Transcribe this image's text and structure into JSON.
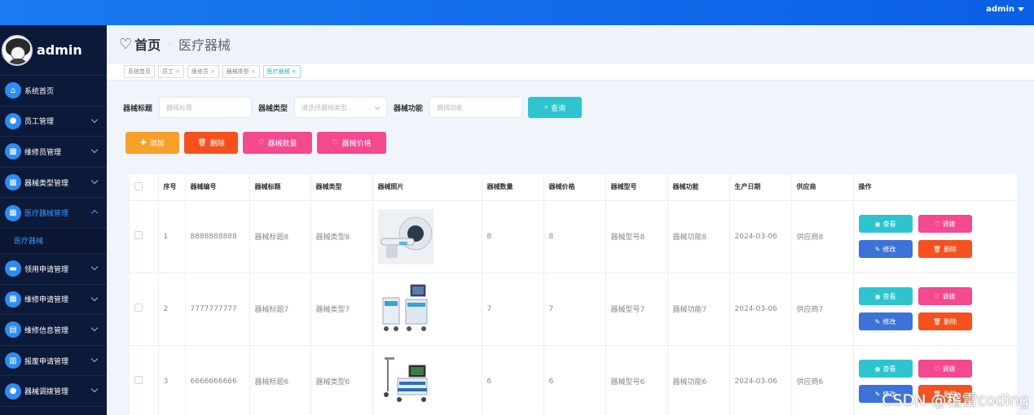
{
  "topbar": {
    "user": "admin"
  },
  "sidebar": {
    "brand": "admin",
    "items": [
      {
        "label": "系统首页",
        "icon": "home-icon",
        "glyph": "⌂",
        "expandable": false
      },
      {
        "label": "员工管理",
        "icon": "balloon-icon",
        "glyph": "●",
        "expandable": true
      },
      {
        "label": "维修员管理",
        "icon": "grid-icon",
        "glyph": "▦",
        "expandable": true
      },
      {
        "label": "器械类型管理",
        "icon": "grid-icon",
        "glyph": "▦",
        "expandable": true
      },
      {
        "label": "医疗器械管理",
        "icon": "grid-icon",
        "glyph": "▦",
        "expandable": true,
        "active": true,
        "sub": "医疗器械"
      },
      {
        "label": "领用申请管理",
        "icon": "ticket-icon",
        "glyph": "▬",
        "expandable": true
      },
      {
        "label": "维修申请管理",
        "icon": "grid-icon",
        "glyph": "▦",
        "expandable": true
      },
      {
        "label": "维修信息管理",
        "icon": "chart-icon",
        "glyph": "▤",
        "expandable": true
      },
      {
        "label": "报废申请管理",
        "icon": "bar-chart-icon",
        "glyph": "▥",
        "expandable": true
      },
      {
        "label": "器械调拨管理",
        "icon": "user-icon",
        "glyph": "●",
        "expandable": true
      }
    ]
  },
  "breadcrumb": {
    "home": "首页",
    "current": "医疗器械"
  },
  "tags": [
    {
      "label": "系统首页",
      "closable": false,
      "active": false
    },
    {
      "label": "员工",
      "closable": true,
      "active": false
    },
    {
      "label": "维修员",
      "closable": true,
      "active": false
    },
    {
      "label": "器械类型",
      "closable": true,
      "active": false
    },
    {
      "label": "医疗器械",
      "closable": true,
      "active": true
    }
  ],
  "search": {
    "title_label": "器械标题",
    "title_placeholder": "器械标题",
    "type_label": "器械类型",
    "type_placeholder": "请选择器械类型",
    "func_label": "器械功能",
    "func_placeholder": "器械功能",
    "query_btn": "查询"
  },
  "actions": {
    "add": "添加",
    "delete": "删除",
    "qty": "器械数量",
    "price": "器械价格"
  },
  "colors": {
    "primary": "#2e8cf3",
    "cyan": "#2dc4d0",
    "pink": "#f4488f",
    "orange": "#f7a12d",
    "red": "#f4511e",
    "blue": "#3c73d8",
    "sidebar": "#0c1a3a"
  },
  "table": {
    "headers": [
      "序号",
      "器械编号",
      "器械标题",
      "器械类型",
      "器械照片",
      "器械数量",
      "器械价格",
      "器械型号",
      "器械功能",
      "生产日期",
      "供应商",
      "操作"
    ],
    "rows": [
      {
        "no": "1",
        "code": "8888888888",
        "title": "器械标题8",
        "type": "器械类型8",
        "photo": "ct-scanner",
        "qty": "8",
        "price": "8",
        "model": "器械型号8",
        "func": "器械功能8",
        "date": "2024-03-06",
        "supplier": "供应商8"
      },
      {
        "no": "2",
        "code": "7777777777",
        "title": "器械标题7",
        "type": "器械类型7",
        "photo": "medical-cart",
        "qty": "7",
        "price": "7",
        "model": "器械型号7",
        "func": "器械功能7",
        "date": "2024-03-06",
        "supplier": "供应商7"
      },
      {
        "no": "3",
        "code": "6666666666",
        "title": "器械标题6",
        "type": "器械类型6",
        "photo": "monitor-station",
        "qty": "6",
        "price": "6",
        "model": "器械型号6",
        "func": "器械功能6",
        "date": "2024-03-06",
        "supplier": "供应商6"
      }
    ],
    "ops": {
      "view": "查看",
      "alloc": "调拨",
      "edit": "修改",
      "del": "删除"
    }
  },
  "watermark": "CSDN @稽雷coding"
}
